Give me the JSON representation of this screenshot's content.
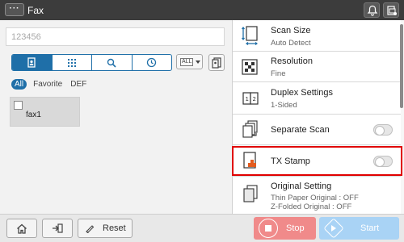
{
  "header": {
    "menu_label": "···",
    "title": "Fax",
    "icons": [
      "bell-icon",
      "device-status-icon"
    ]
  },
  "left": {
    "destination_input": {
      "value": "123456"
    },
    "tabs": [
      {
        "icon": "address-book-icon",
        "active": true
      },
      {
        "icon": "keypad-icon",
        "active": false
      },
      {
        "icon": "search-icon",
        "active": false
      },
      {
        "icon": "history-icon",
        "active": false
      }
    ],
    "filter_label": "ALL",
    "index": [
      "All",
      "Favorite",
      "DEF"
    ],
    "destinations": [
      {
        "name": "fax1",
        "checked": false
      }
    ]
  },
  "settings": [
    {
      "title": "Scan Size",
      "subtitle": "Auto Detect",
      "icon": "scan-size-icon"
    },
    {
      "title": "Resolution",
      "subtitle": "Fine",
      "icon": "resolution-icon"
    },
    {
      "title": "Duplex Settings",
      "subtitle": "1-Sided",
      "icon": "duplex-icon"
    },
    {
      "title": "Separate Scan",
      "toggle": false,
      "icon": "separate-scan-icon"
    },
    {
      "title": "TX Stamp",
      "toggle": false,
      "icon": "tx-stamp-icon"
    },
    {
      "title": "Original Setting",
      "subtitle_lines": [
        "Thin Paper Original : OFF",
        "Z-Folded Original : OFF"
      ],
      "icon": "original-setting-icon"
    }
  ],
  "bottom": {
    "reset_label": "Reset",
    "stop_label": "Stop",
    "start_label": "Start"
  },
  "colors": {
    "accent": "#1f6fa8",
    "highlight": "#e00000",
    "stop": "#f08a8a",
    "start": "#a9d3f5"
  }
}
